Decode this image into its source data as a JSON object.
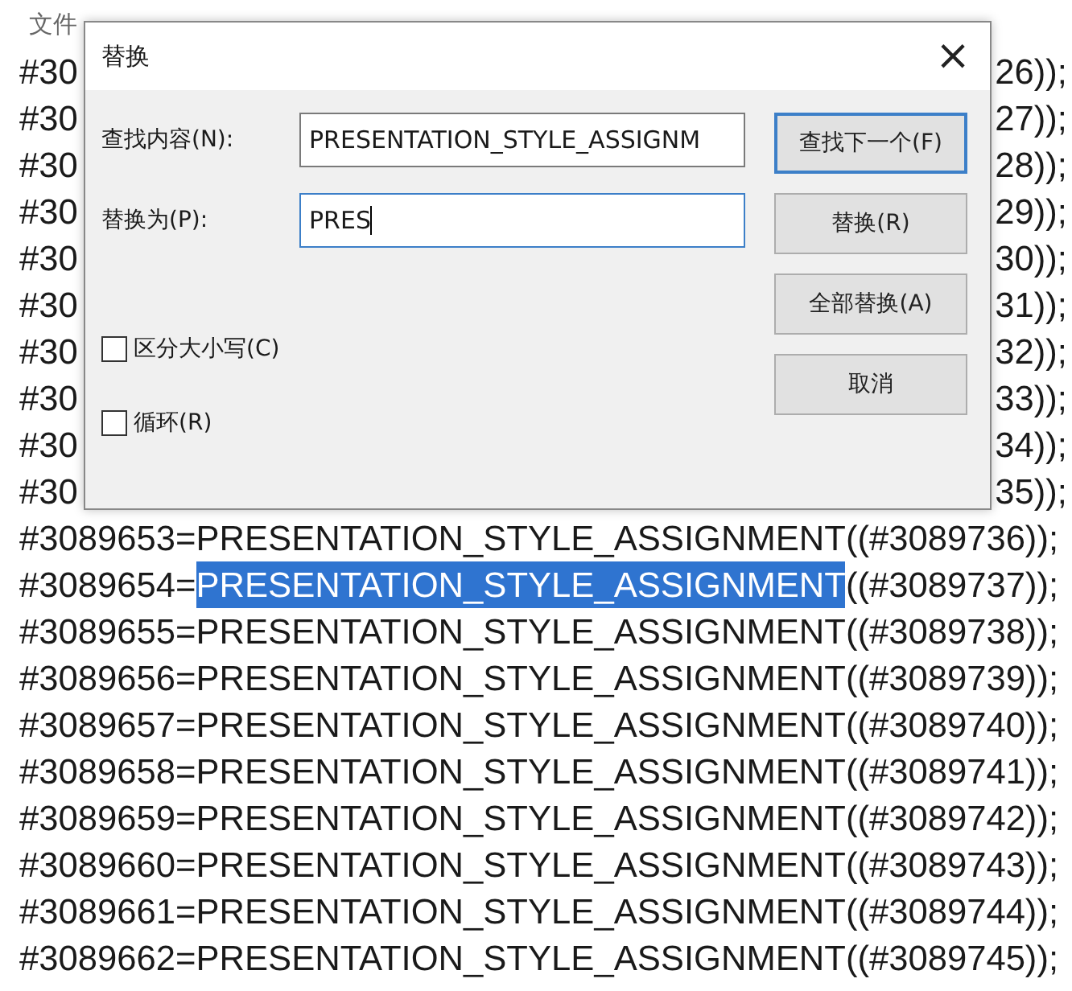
{
  "menu": {
    "visible_item": "文件"
  },
  "dialog": {
    "title": "替换",
    "close": "×",
    "find": {
      "label": "查找内容(N):",
      "value": "PRESENTATION_STYLE_ASSIGNM"
    },
    "replace": {
      "label": "替换为(P):",
      "value": "PRES",
      "focused": true
    },
    "buttons": [
      {
        "label": "查找下一个(F)",
        "default": true
      },
      {
        "label": "替换(R)",
        "default": false
      },
      {
        "label": "全部替换(A)",
        "default": false
      },
      {
        "label": "取消",
        "default": false
      }
    ],
    "options": [
      {
        "label": "区分大小写(C)",
        "checked": false
      },
      {
        "label": "循环(R)",
        "checked": false
      }
    ]
  },
  "lines": [
    {
      "kind": "covered",
      "left": "#30",
      "right": "26));"
    },
    {
      "kind": "covered",
      "left": "#30",
      "right": "27));"
    },
    {
      "kind": "covered",
      "left": "#30",
      "right": "28));"
    },
    {
      "kind": "covered",
      "left": "#30",
      "right": "29));"
    },
    {
      "kind": "covered",
      "left": "#30",
      "right": "30));"
    },
    {
      "kind": "covered",
      "left": "#30",
      "right": "31));"
    },
    {
      "kind": "covered",
      "left": "#30",
      "right": "32));"
    },
    {
      "kind": "covered",
      "left": "#30",
      "right": "33));"
    },
    {
      "kind": "covered",
      "left": "#30",
      "right": "34));"
    },
    {
      "kind": "covered",
      "left": "#30",
      "right": "35));"
    },
    {
      "kind": "full",
      "segments": [
        {
          "text": "#3089653=PRESENTATION_STYLE_ASSIGNMENT((#3089736));",
          "selected": false
        }
      ]
    },
    {
      "kind": "full",
      "segments": [
        {
          "text": "#3089654=",
          "selected": false
        },
        {
          "text": "PRESENTATION_STYLE_ASSIGNMENT",
          "selected": true
        },
        {
          "text": "((#3089737));",
          "selected": false
        }
      ]
    },
    {
      "kind": "full",
      "segments": [
        {
          "text": "#3089655=PRESENTATION_STYLE_ASSIGNMENT((#3089738));",
          "selected": false
        }
      ]
    },
    {
      "kind": "full",
      "segments": [
        {
          "text": "#3089656=PRESENTATION_STYLE_ASSIGNMENT((#3089739));",
          "selected": false
        }
      ]
    },
    {
      "kind": "full",
      "segments": [
        {
          "text": "#3089657=PRESENTATION_STYLE_ASSIGNMENT((#3089740));",
          "selected": false
        }
      ]
    },
    {
      "kind": "full",
      "segments": [
        {
          "text": "#3089658=PRESENTATION_STYLE_ASSIGNMENT((#3089741));",
          "selected": false
        }
      ]
    },
    {
      "kind": "full",
      "segments": [
        {
          "text": "#3089659=PRESENTATION_STYLE_ASSIGNMENT((#3089742));",
          "selected": false
        }
      ]
    },
    {
      "kind": "full",
      "segments": [
        {
          "text": "#3089660=PRESENTATION_STYLE_ASSIGNMENT((#3089743));",
          "selected": false
        }
      ]
    },
    {
      "kind": "full",
      "segments": [
        {
          "text": "#3089661=PRESENTATION_STYLE_ASSIGNMENT((#3089744));",
          "selected": false
        }
      ]
    },
    {
      "kind": "full",
      "segments": [
        {
          "text": "#3089662=PRESENTATION_STYLE_ASSIGNMENT((#3089745));",
          "selected": false
        }
      ]
    }
  ]
}
